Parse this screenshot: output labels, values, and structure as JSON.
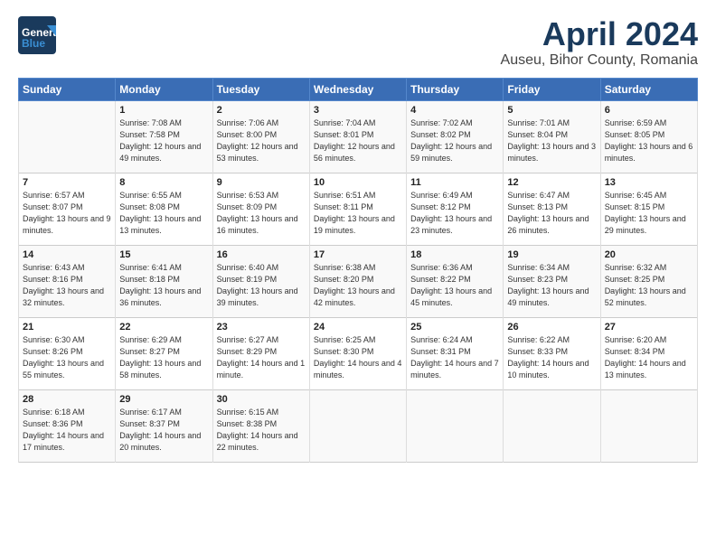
{
  "header": {
    "logo_line1": "General",
    "logo_line2": "Blue",
    "title": "April 2024",
    "subtitle": "Auseu, Bihor County, Romania"
  },
  "calendar": {
    "days_of_week": [
      "Sunday",
      "Monday",
      "Tuesday",
      "Wednesday",
      "Thursday",
      "Friday",
      "Saturday"
    ],
    "weeks": [
      [
        {
          "day": "",
          "sunrise": "",
          "sunset": "",
          "daylight": ""
        },
        {
          "day": "1",
          "sunrise": "Sunrise: 7:08 AM",
          "sunset": "Sunset: 7:58 PM",
          "daylight": "Daylight: 12 hours and 49 minutes."
        },
        {
          "day": "2",
          "sunrise": "Sunrise: 7:06 AM",
          "sunset": "Sunset: 8:00 PM",
          "daylight": "Daylight: 12 hours and 53 minutes."
        },
        {
          "day": "3",
          "sunrise": "Sunrise: 7:04 AM",
          "sunset": "Sunset: 8:01 PM",
          "daylight": "Daylight: 12 hours and 56 minutes."
        },
        {
          "day": "4",
          "sunrise": "Sunrise: 7:02 AM",
          "sunset": "Sunset: 8:02 PM",
          "daylight": "Daylight: 12 hours and 59 minutes."
        },
        {
          "day": "5",
          "sunrise": "Sunrise: 7:01 AM",
          "sunset": "Sunset: 8:04 PM",
          "daylight": "Daylight: 13 hours and 3 minutes."
        },
        {
          "day": "6",
          "sunrise": "Sunrise: 6:59 AM",
          "sunset": "Sunset: 8:05 PM",
          "daylight": "Daylight: 13 hours and 6 minutes."
        }
      ],
      [
        {
          "day": "7",
          "sunrise": "Sunrise: 6:57 AM",
          "sunset": "Sunset: 8:07 PM",
          "daylight": "Daylight: 13 hours and 9 minutes."
        },
        {
          "day": "8",
          "sunrise": "Sunrise: 6:55 AM",
          "sunset": "Sunset: 8:08 PM",
          "daylight": "Daylight: 13 hours and 13 minutes."
        },
        {
          "day": "9",
          "sunrise": "Sunrise: 6:53 AM",
          "sunset": "Sunset: 8:09 PM",
          "daylight": "Daylight: 13 hours and 16 minutes."
        },
        {
          "day": "10",
          "sunrise": "Sunrise: 6:51 AM",
          "sunset": "Sunset: 8:11 PM",
          "daylight": "Daylight: 13 hours and 19 minutes."
        },
        {
          "day": "11",
          "sunrise": "Sunrise: 6:49 AM",
          "sunset": "Sunset: 8:12 PM",
          "daylight": "Daylight: 13 hours and 23 minutes."
        },
        {
          "day": "12",
          "sunrise": "Sunrise: 6:47 AM",
          "sunset": "Sunset: 8:13 PM",
          "daylight": "Daylight: 13 hours and 26 minutes."
        },
        {
          "day": "13",
          "sunrise": "Sunrise: 6:45 AM",
          "sunset": "Sunset: 8:15 PM",
          "daylight": "Daylight: 13 hours and 29 minutes."
        }
      ],
      [
        {
          "day": "14",
          "sunrise": "Sunrise: 6:43 AM",
          "sunset": "Sunset: 8:16 PM",
          "daylight": "Daylight: 13 hours and 32 minutes."
        },
        {
          "day": "15",
          "sunrise": "Sunrise: 6:41 AM",
          "sunset": "Sunset: 8:18 PM",
          "daylight": "Daylight: 13 hours and 36 minutes."
        },
        {
          "day": "16",
          "sunrise": "Sunrise: 6:40 AM",
          "sunset": "Sunset: 8:19 PM",
          "daylight": "Daylight: 13 hours and 39 minutes."
        },
        {
          "day": "17",
          "sunrise": "Sunrise: 6:38 AM",
          "sunset": "Sunset: 8:20 PM",
          "daylight": "Daylight: 13 hours and 42 minutes."
        },
        {
          "day": "18",
          "sunrise": "Sunrise: 6:36 AM",
          "sunset": "Sunset: 8:22 PM",
          "daylight": "Daylight: 13 hours and 45 minutes."
        },
        {
          "day": "19",
          "sunrise": "Sunrise: 6:34 AM",
          "sunset": "Sunset: 8:23 PM",
          "daylight": "Daylight: 13 hours and 49 minutes."
        },
        {
          "day": "20",
          "sunrise": "Sunrise: 6:32 AM",
          "sunset": "Sunset: 8:25 PM",
          "daylight": "Daylight: 13 hours and 52 minutes."
        }
      ],
      [
        {
          "day": "21",
          "sunrise": "Sunrise: 6:30 AM",
          "sunset": "Sunset: 8:26 PM",
          "daylight": "Daylight: 13 hours and 55 minutes."
        },
        {
          "day": "22",
          "sunrise": "Sunrise: 6:29 AM",
          "sunset": "Sunset: 8:27 PM",
          "daylight": "Daylight: 13 hours and 58 minutes."
        },
        {
          "day": "23",
          "sunrise": "Sunrise: 6:27 AM",
          "sunset": "Sunset: 8:29 PM",
          "daylight": "Daylight: 14 hours and 1 minute."
        },
        {
          "day": "24",
          "sunrise": "Sunrise: 6:25 AM",
          "sunset": "Sunset: 8:30 PM",
          "daylight": "Daylight: 14 hours and 4 minutes."
        },
        {
          "day": "25",
          "sunrise": "Sunrise: 6:24 AM",
          "sunset": "Sunset: 8:31 PM",
          "daylight": "Daylight: 14 hours and 7 minutes."
        },
        {
          "day": "26",
          "sunrise": "Sunrise: 6:22 AM",
          "sunset": "Sunset: 8:33 PM",
          "daylight": "Daylight: 14 hours and 10 minutes."
        },
        {
          "day": "27",
          "sunrise": "Sunrise: 6:20 AM",
          "sunset": "Sunset: 8:34 PM",
          "daylight": "Daylight: 14 hours and 13 minutes."
        }
      ],
      [
        {
          "day": "28",
          "sunrise": "Sunrise: 6:18 AM",
          "sunset": "Sunset: 8:36 PM",
          "daylight": "Daylight: 14 hours and 17 minutes."
        },
        {
          "day": "29",
          "sunrise": "Sunrise: 6:17 AM",
          "sunset": "Sunset: 8:37 PM",
          "daylight": "Daylight: 14 hours and 20 minutes."
        },
        {
          "day": "30",
          "sunrise": "Sunrise: 6:15 AM",
          "sunset": "Sunset: 8:38 PM",
          "daylight": "Daylight: 14 hours and 22 minutes."
        },
        {
          "day": "",
          "sunrise": "",
          "sunset": "",
          "daylight": ""
        },
        {
          "day": "",
          "sunrise": "",
          "sunset": "",
          "daylight": ""
        },
        {
          "day": "",
          "sunrise": "",
          "sunset": "",
          "daylight": ""
        },
        {
          "day": "",
          "sunrise": "",
          "sunset": "",
          "daylight": ""
        }
      ]
    ]
  }
}
